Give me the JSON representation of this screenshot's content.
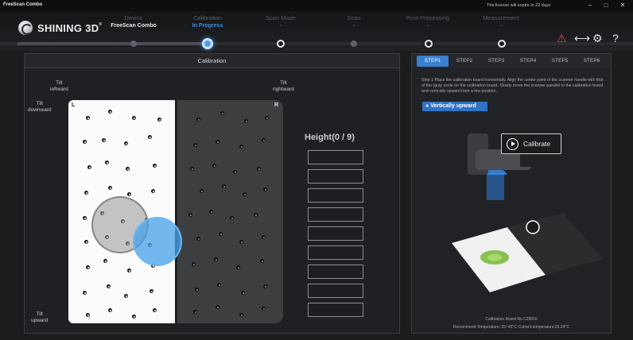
{
  "window": {
    "title": "FreeScan Combo",
    "license": "The license will expire in 22 days",
    "controls": [
      "–",
      "□",
      "✕"
    ]
  },
  "header": {
    "brand": "SHINING 3D",
    "brand_mark": "®",
    "steps": [
      {
        "label": "Device",
        "sub": "FreeScan Combo"
      },
      {
        "label": "Calibration",
        "sub": "In Progress"
      },
      {
        "label": "Scan Mode",
        "sub": "-"
      },
      {
        "label": "Scan",
        "sub": "-"
      },
      {
        "label": "Post Processing",
        "sub": "-"
      },
      {
        "label": "Measurement",
        "sub": "-"
      }
    ],
    "icons": [
      "device-alert-icon",
      "share-icon",
      "settings-icon",
      "help-icon"
    ]
  },
  "calibration": {
    "title": "Calibration",
    "tilt_leftward": "Tilt\nleftward",
    "tilt_rightward": "Tilt\nrightward",
    "tilt_downward": "Tilt\ndownward",
    "tilt_upward": "Tilt\nupward",
    "board_left": "L",
    "board_right": "R",
    "height_title": "Height(0 / 9)",
    "height_progress": {
      "done": 0,
      "total": 9
    }
  },
  "guide": {
    "tabs": [
      "STEP1",
      "STEP2",
      "STEP3",
      "STEP4",
      "STEP5",
      "STEP6"
    ],
    "active_tab": "STEP1",
    "instruction": "Step 1 Place the calibration board horizontally. Align the center point of the scanner handle with that of the (gray circle on the calibration board. Slowly move the scanner parallel to the calibration board and vertically upward from a low position.",
    "direction_button": "Vertically upward",
    "calibrate_button": "Calibrate",
    "board_no": "Calibration Board No.C29816",
    "temperature": "Recommend Temperature: 25~45°C Current temperature:25.24°C"
  },
  "colors": {
    "accent": "#3b7fd0",
    "active_step": "#3f8fe0",
    "background": "#1b1c1e"
  }
}
